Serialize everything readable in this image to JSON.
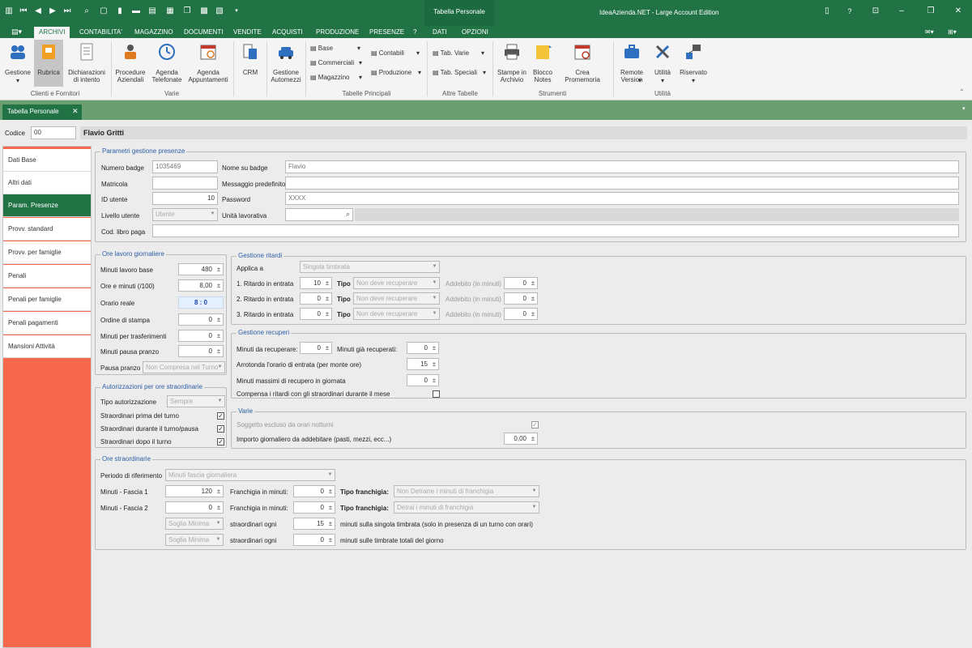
{
  "window": {
    "doc_title": "Tabella Personale",
    "app_title": "IdeaAzienda.NET - Large Account Edition"
  },
  "menu": [
    "ARCHIVI",
    "CONTABILITA'",
    "MAGAZZINO",
    "DOCUMENTI",
    "VENDITE",
    "ACQUISTI",
    "PRODUZIONE",
    "PRESENZE",
    "?",
    "DATI",
    "OPZIONI"
  ],
  "ribbon": {
    "buttons": {
      "gestione": "Gestione",
      "rubrica": "Rubrica",
      "dichiarazioni": "Dichiarazioni di intento",
      "procedure": "Procedure Aziendali",
      "agenda_tel": "Agenda Telefonate",
      "agenda_app": "Agenda Appuntamenti",
      "crm": "CRM",
      "gestione_automezzi": "Gestione Automezzi",
      "base": "Base",
      "commerciali": "Commerciali",
      "magazzino": "Magazzino",
      "contabili": "Contabili",
      "produzione": "Produzione",
      "tab_varie": "Tab. Varie",
      "tab_speciali": "Tab. Speciali",
      "stampe": "Stampe in Archivio",
      "blocco": "Blocco Notes",
      "promemoria": "Crea Promemoria",
      "remote": "Remote Version",
      "utilita": "Utilità",
      "riservato": "Riservato"
    },
    "groups": {
      "clienti": "Clienti e Fornitori",
      "varie": "Varie",
      "tabelle": "Tabelle Principali",
      "altre": "Altre Tabelle",
      "strumenti": "Strumenti",
      "utilita": "Utilità"
    }
  },
  "doc_tab": "Tabella Personale",
  "header": {
    "codice_label": "Codice",
    "codice_value": "00",
    "name": "Flavio Gritti"
  },
  "nav": [
    "Dati Base",
    "Altri dati",
    "Param. Presenze",
    "Provv. standard",
    "Provv. per famiglie",
    "Penali",
    "Penali per famiglie",
    "Penali pagamenti",
    "Mansioni Attività"
  ],
  "parametri": {
    "title": "Parametri gestione presenze",
    "numero_badge_label": "Numero badge",
    "numero_badge": "1035469",
    "nome_badge_label": "Nome su badge",
    "nome_badge": "Flavio",
    "matricola_label": "Matricola",
    "messaggio_label": "Messaggio predefinito",
    "id_utente_label": "ID utente",
    "id_utente": "10",
    "password_label": "Password",
    "password": "XXXX",
    "livello_label": "Livello utente",
    "livello": "Utente",
    "unita_label": "Unità lavorativa",
    "cod_libro_label": "Cod. libro paga"
  },
  "ore_lavoro": {
    "title": "Ore lavoro giornaliere",
    "minuti_base_label": "Minuti lavoro base",
    "minuti_base": "480",
    "ore_minuti_label": "Ore e minuti (/100)",
    "ore_minuti": "8,00",
    "orario_reale_label": "Orario reale",
    "orario_reale": "8 : 0",
    "ordine_label": "Ordine di stampa",
    "ordine": "0",
    "trasf_label": "Minuti per trasferimenti",
    "trasf": "0",
    "pausa_min_label": "Minuti pausa pranzo",
    "pausa_min": "0",
    "pausa_label": "Pausa pranzo",
    "pausa": "Non Compresa nel Turno"
  },
  "autorizzazioni": {
    "title": "Autorizzazioni per ore straordinarie",
    "tipo_label": "Tipo autorizzazione",
    "tipo": "Sempre",
    "prima": "Straordinari prima del turno",
    "durante": "Straordinari durante il turno/pausa",
    "dopo": "Straordinari dopo il turno"
  },
  "ritardi": {
    "title": "Gestione ritardi",
    "applica_label": "Applica a",
    "applica": "Singola timbrata",
    "rows": [
      {
        "label": "1. Ritardo in entrata",
        "value": "10",
        "tipo": "Non deve recuperare",
        "addebito": "0"
      },
      {
        "label": "2. Ritardo in entrata",
        "value": "0",
        "tipo": "Non deve recuperare",
        "addebito": "0"
      },
      {
        "label": "3. Ritardo in entrata",
        "value": "0",
        "tipo": "Non deve recuperare",
        "addebito": "0"
      }
    ],
    "tipo_label": "Tipo",
    "addebito_label": "Addebito (in minuti)"
  },
  "recuperi": {
    "title": "Gestione recuperi",
    "da_recuperare_label": "Minuti da recuperare:",
    "da_recuperare": "0",
    "gia_recuperati_label": "Minuti già recuperati:",
    "gia_recuperati": "0",
    "arrotonda_label": "Arrotonda l'orario di entrata (per monte ore)",
    "arrotonda": "15",
    "massimi_label": "Minuti massimi di recupero in giornata",
    "massimi": "0",
    "compensa_label": "Compensa i ritardi con gli straordinari durante il mese"
  },
  "varie": {
    "title": "Varie",
    "soggetto_label": "Soggetto escluso da orari notturni",
    "importo_label": "Importo giornaliero da addebitare (pasti, mezzi, ecc...)",
    "importo": "0,00"
  },
  "straordinarie": {
    "title": "Ore straordinarie",
    "periodo_label": "Periodo di riferimento",
    "periodo": "Minuti fascia giornaliera",
    "fascia1_label": "Minuti - Fascia 1",
    "fascia1": "120",
    "fascia2_label": "Minuti - Fascia 2",
    "fascia2": "0",
    "franchigia_label": "Franchigia in minuti:",
    "franchigia1": "0",
    "franchigia2": "0",
    "tipo_franchigia_label": "Tipo franchigia:",
    "tipo_franchigia1": "Non Detrarre i minuti di franchigia",
    "tipo_franchigia2": "Detrai i minuti di franchigia",
    "soglia": "Soglia Minima",
    "ogni_label": "straordinari ogni",
    "ogni1": "15",
    "ogni2": "0",
    "ogni1_desc": "minuti sulla singola timbrata (solo in presenza di un turno con orari)",
    "ogni2_desc": "minuti sulle timbrate totali del giorno"
  }
}
